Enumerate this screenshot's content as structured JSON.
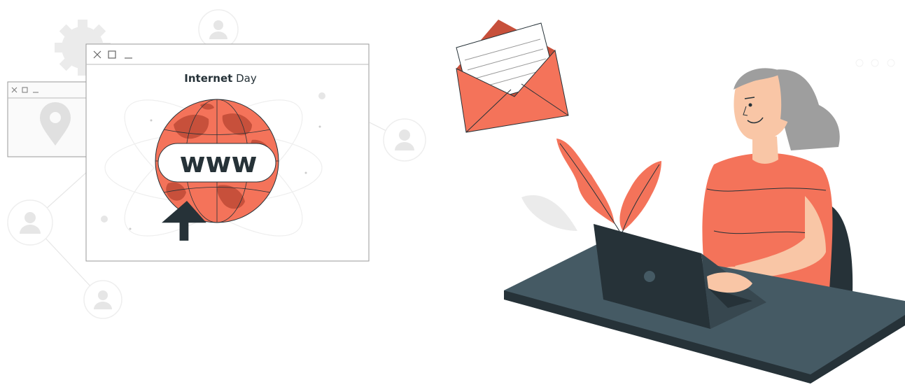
{
  "main_window": {
    "title_bold": "Internet",
    "title_rest": " Day",
    "globe_label": "www"
  },
  "colors": {
    "accent": "#f4735a",
    "accent_dark": "#d95a43",
    "dark": "#263238",
    "desk": "#455a64",
    "skin": "#f9c6a6",
    "hair": "#9e9e9e",
    "ghost": "#ebebeb"
  },
  "icons": [
    "gear-icon",
    "user-icon",
    "location-pin-icon",
    "cursor-arrow-icon",
    "envelope-icon",
    "laptop-icon"
  ]
}
